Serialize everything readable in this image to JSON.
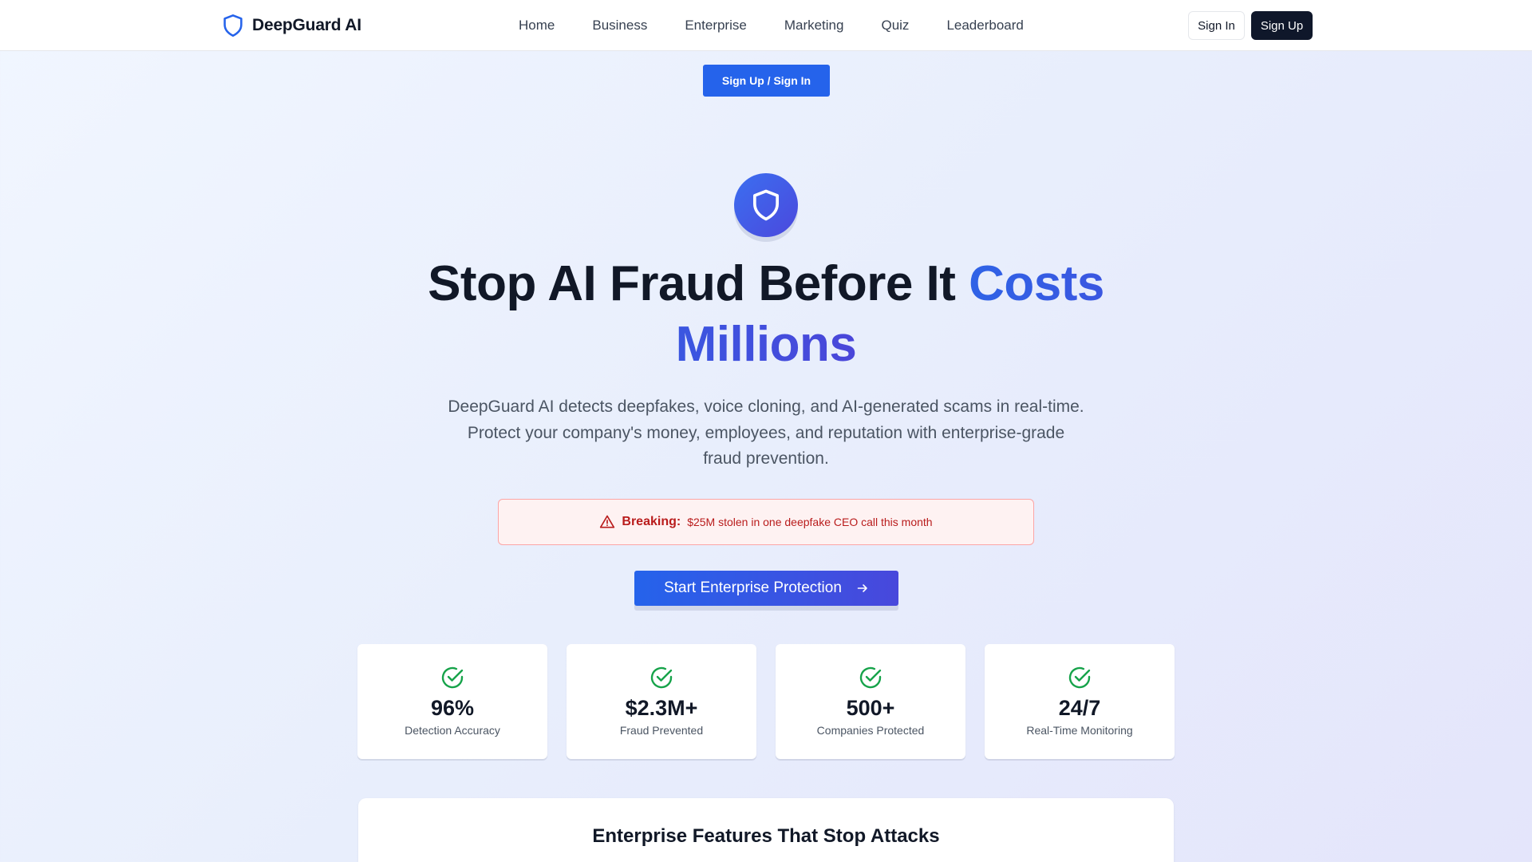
{
  "header": {
    "brand_name": "DeepGuard AI",
    "brand_icon": "shield-icon",
    "nav": [
      "Home",
      "Business",
      "Enterprise",
      "Marketing",
      "Quiz",
      "Leaderboard"
    ],
    "sign_in_label": "Sign In",
    "sign_up_label": "Sign Up"
  },
  "top_cta": {
    "label": "Sign Up / Sign In"
  },
  "hero": {
    "icon": "shield-icon",
    "title_main": "Stop AI Fraud Before It ",
    "title_accent": "Costs Millions",
    "subtitle": "DeepGuard AI detects deepfakes, voice cloning, and AI-generated scams in real-time. Protect your company's money, employees, and reputation with enterprise-grade fraud prevention."
  },
  "alert": {
    "icon": "warning-triangle-icon",
    "strong": "Breaking:",
    "text": "$25M stolen in one deepfake CEO call this month"
  },
  "main_cta": {
    "label": "Start Enterprise Protection",
    "icon": "arrow-right-icon"
  },
  "stats": [
    {
      "icon": "check-circle-icon",
      "value": "96%",
      "label": "Detection Accuracy"
    },
    {
      "icon": "check-circle-icon",
      "value": "$2.3M+",
      "label": "Fraud Prevented"
    },
    {
      "icon": "check-circle-icon",
      "value": "500+",
      "label": "Companies Protected"
    },
    {
      "icon": "check-circle-icon",
      "value": "24/7",
      "label": "Real-Time Monitoring"
    }
  ],
  "features": {
    "title": "Enterprise Features That Stop Attacks"
  },
  "colors": {
    "primary": "#2563eb",
    "accent_indigo": "#4a46d9",
    "dark": "#0f172a",
    "alert_red": "#b91c1c",
    "success_green": "#16a34a"
  }
}
